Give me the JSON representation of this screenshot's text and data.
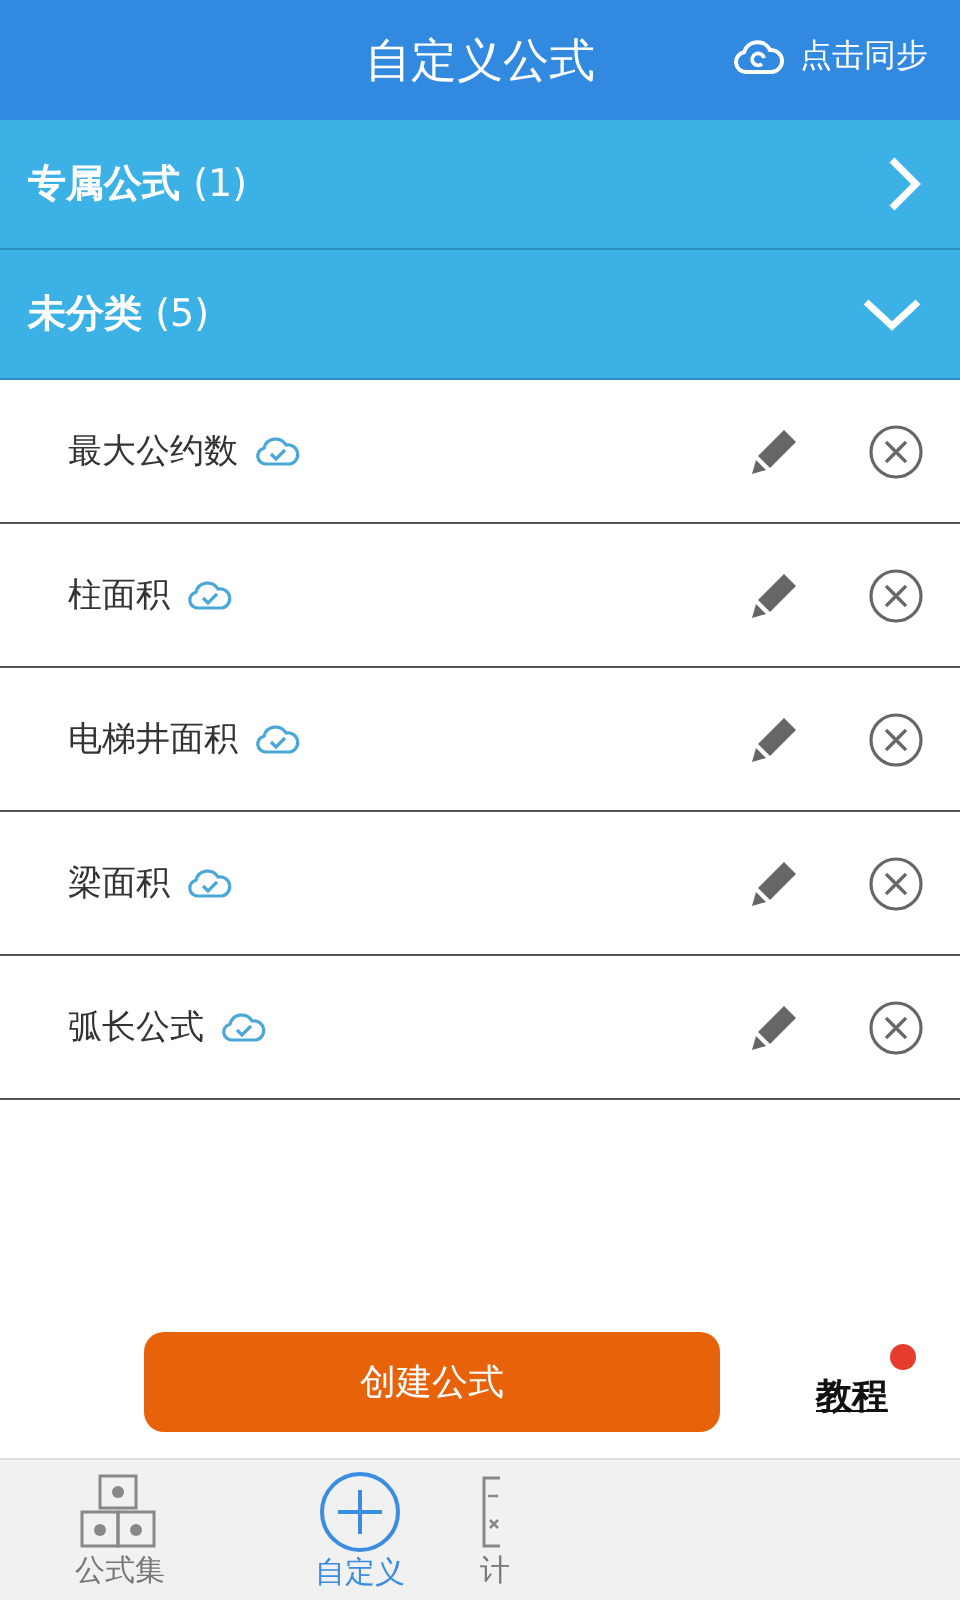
{
  "header": {
    "title": "自定义公式",
    "sync_label": "点击同步"
  },
  "groups": [
    {
      "name": "专属公式",
      "count": "(1)",
      "expanded": false
    },
    {
      "name": "未分类",
      "count": "(5)",
      "expanded": true
    }
  ],
  "formulas": [
    {
      "name": "最大公约数",
      "synced": true
    },
    {
      "name": "柱面积",
      "synced": true
    },
    {
      "name": "电梯井面积",
      "synced": true
    },
    {
      "name": "梁面积",
      "synced": true
    },
    {
      "name": "弧长公式",
      "synced": true
    }
  ],
  "create_button": "创建公式",
  "tutorial": {
    "label": "教程",
    "badge": true
  },
  "nav": [
    {
      "label": "公式集",
      "kind": "abc",
      "selected": false
    },
    {
      "label": "自定义",
      "kind": "plus",
      "selected": true
    },
    {
      "label": "计",
      "kind": "calc",
      "selected": false
    }
  ]
}
